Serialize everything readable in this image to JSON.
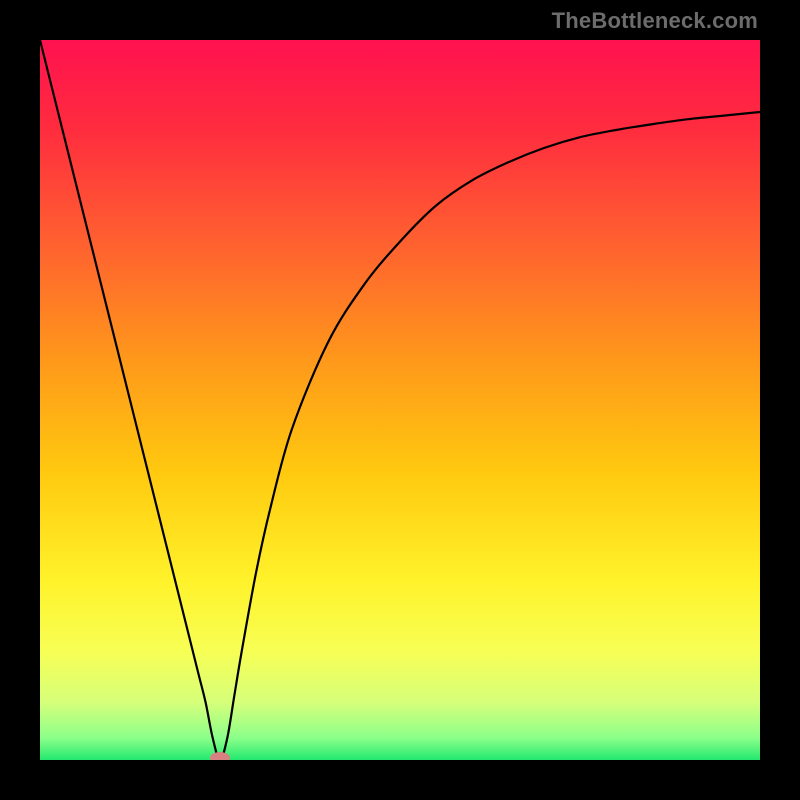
{
  "watermark": "TheBottleneck.com",
  "chart_data": {
    "type": "line",
    "title": "",
    "xlabel": "",
    "ylabel": "",
    "xlim": [
      0,
      100
    ],
    "ylim": [
      0,
      100
    ],
    "x": [
      0,
      5,
      10,
      15,
      18,
      20,
      22,
      23,
      24,
      25,
      26,
      27,
      28,
      30,
      32,
      35,
      40,
      45,
      50,
      55,
      60,
      65,
      70,
      75,
      80,
      85,
      90,
      95,
      100
    ],
    "values": [
      100,
      80,
      60,
      40,
      28,
      20,
      12,
      8,
      3,
      0,
      3,
      9,
      15,
      26,
      35,
      46,
      58,
      66,
      72,
      77,
      80.5,
      83,
      85,
      86.5,
      87.5,
      88.3,
      89,
      89.5,
      90
    ],
    "marker_point": {
      "x": 25,
      "y": 0
    },
    "background_gradient": {
      "stops": [
        {
          "pos": 0.0,
          "color": "#ff1250"
        },
        {
          "pos": 0.12,
          "color": "#ff2b3f"
        },
        {
          "pos": 0.28,
          "color": "#ff6030"
        },
        {
          "pos": 0.45,
          "color": "#ff9a1a"
        },
        {
          "pos": 0.6,
          "color": "#ffc90f"
        },
        {
          "pos": 0.75,
          "color": "#fff22a"
        },
        {
          "pos": 0.85,
          "color": "#f7ff55"
        },
        {
          "pos": 0.92,
          "color": "#d6ff7a"
        },
        {
          "pos": 0.97,
          "color": "#8aff8a"
        },
        {
          "pos": 1.0,
          "color": "#23e86f"
        }
      ]
    }
  }
}
